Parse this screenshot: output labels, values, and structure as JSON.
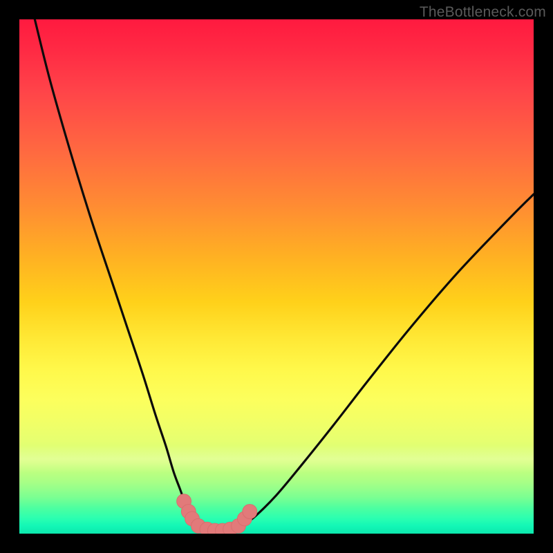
{
  "watermark": {
    "text": "TheBottleneck.com"
  },
  "colors": {
    "frame": "#000000",
    "curve": "#0b0b0b",
    "marker_fill": "#e27a7a",
    "marker_stroke": "#d86e6e",
    "gradient_stops": [
      "#ff1a3f",
      "#ff6a40",
      "#ffd11a",
      "#fcff5d",
      "#4dffa0",
      "#0ce8ad"
    ]
  },
  "chart_data": {
    "type": "line",
    "title": "",
    "xlabel": "",
    "ylabel": "",
    "xlim": [
      0,
      100
    ],
    "ylim": [
      0,
      100
    ],
    "grid": false,
    "legend": false,
    "series": [
      {
        "name": "left-branch",
        "x": [
          3,
          6,
          10,
          14,
          18,
          21,
          24,
          26.5,
          28.5,
          30,
          31.3,
          32.2,
          33,
          33.8,
          34.5
        ],
        "y": [
          100,
          88,
          74,
          61,
          49,
          40,
          31,
          23,
          17,
          12,
          8.5,
          6,
          4.2,
          2.7,
          1.6
        ]
      },
      {
        "name": "trough",
        "x": [
          34.5,
          36,
          38,
          40,
          42,
          43.5
        ],
        "y": [
          1.6,
          0.8,
          0.55,
          0.55,
          0.8,
          1.6
        ]
      },
      {
        "name": "right-branch",
        "x": [
          43.5,
          46,
          50,
          55,
          61,
          68,
          76,
          85,
          95,
          100
        ],
        "y": [
          1.6,
          3.5,
          7.5,
          13.5,
          21,
          30,
          40,
          50.5,
          61,
          66
        ]
      }
    ],
    "markers": {
      "name": "highlight-points",
      "shape": "circle",
      "radius_pct": 1.4,
      "x": [
        32.0,
        32.9,
        33.6,
        34.8,
        36.5,
        38.0,
        39.5,
        41.0,
        42.6,
        43.8,
        44.8
      ],
      "y": [
        6.3,
        4.3,
        2.9,
        1.5,
        0.85,
        0.6,
        0.6,
        0.85,
        1.5,
        2.9,
        4.3
      ]
    }
  }
}
